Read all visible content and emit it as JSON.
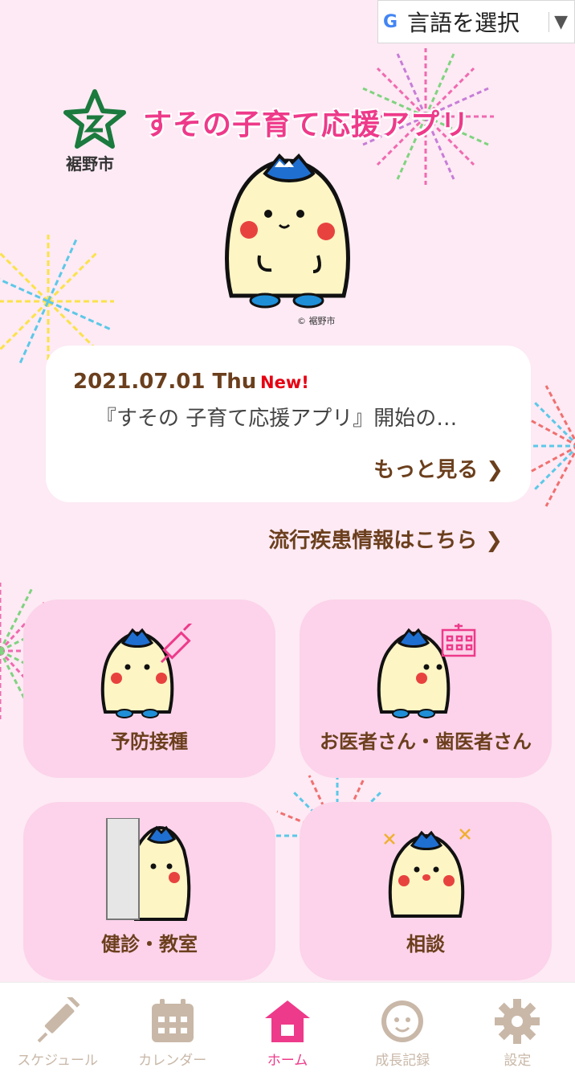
{
  "translate": {
    "label": "言語を選択",
    "g_logo": "G"
  },
  "header": {
    "app_title": "すその子育て応援アプリ",
    "city_name": "裾野市",
    "copyright": "© 裾野市"
  },
  "news": {
    "date": "2021.07.01 Thu",
    "badge": "New!",
    "text": "『すその 子育て応援アプリ』開始の…",
    "more_label": "もっと見る"
  },
  "disease_link": "流行疾患情報はこちら",
  "tiles": [
    {
      "label": "予防接種"
    },
    {
      "label": "お医者さん・歯医者さん"
    },
    {
      "label": "健診・教室"
    },
    {
      "label": "相談"
    }
  ],
  "nav": [
    {
      "label": "スケジュール",
      "icon": "syringe-icon"
    },
    {
      "label": "カレンダー",
      "icon": "calendar-icon"
    },
    {
      "label": "ホーム",
      "icon": "home-icon"
    },
    {
      "label": "成長記録",
      "icon": "baby-face-icon"
    },
    {
      "label": "設定",
      "icon": "gear-icon"
    }
  ],
  "colors": {
    "brand_pink": "#ee3a8a",
    "brown": "#6b3f1d",
    "tile": "#fcd3ea",
    "background": "#fdeaf4",
    "nav_inactive": "#c9b8a8"
  }
}
